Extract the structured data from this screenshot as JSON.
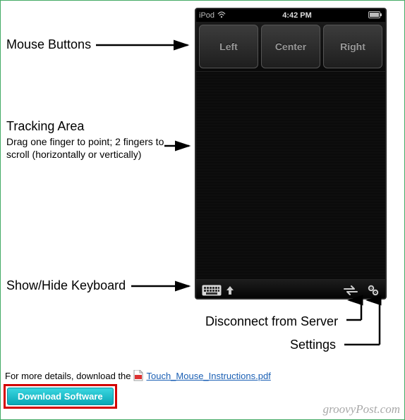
{
  "labels": {
    "mouse_buttons": "Mouse Buttons",
    "tracking_area_title": "Tracking Area",
    "tracking_area_desc": "Drag one finger to point; 2 fingers to scroll (horizontally or vertically)",
    "show_hide_keyboard": "Show/Hide Keyboard",
    "disconnect": "Disconnect from Server",
    "settings": "Settings"
  },
  "ipod": {
    "status_left": "iPod",
    "status_time": "4:42 PM",
    "buttons": {
      "left": "Left",
      "center": "Center",
      "right": "Right"
    }
  },
  "footer": {
    "details_prefix": "For more details, download the",
    "pdf_link_text": "Touch_Mouse_Instructions.pdf",
    "download_button": "Download Software"
  },
  "watermark": "groovyPost.com"
}
